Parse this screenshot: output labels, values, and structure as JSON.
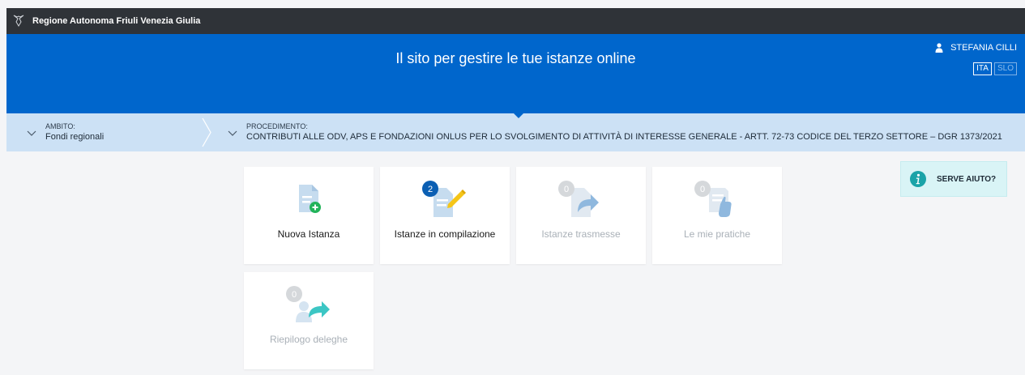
{
  "topbar": {
    "region": "Regione Autonoma Friuli Venezia Giulia"
  },
  "header": {
    "title": "Il sito per gestire le tue istanze online",
    "user": "STEFANIA CILLI",
    "languages": [
      "ITA",
      "SLO"
    ]
  },
  "breadcrumb": {
    "ambito_label": "AMBITO:",
    "ambito_value": "Fondi regionali",
    "procedimento_label": "PROCEDIMENTO:",
    "procedimento_value": "CONTRIBUTI ALLE ODV, APS E FONDAZIONI ONLUS PER LO SVOLGIMENTO DI ATTIVITÀ DI INTERESSE GENERALE - ARTT. 72-73 CODICE DEL TERZO SETTORE – DGR 1373/2021"
  },
  "tiles": [
    {
      "label": "Nuova Istanza",
      "badge": "",
      "state": "active"
    },
    {
      "label": "Istanze in compilazione",
      "badge": "2",
      "state": "active"
    },
    {
      "label": "Istanze trasmesse",
      "badge": "0",
      "state": "disabled"
    },
    {
      "label": "Le mie pratiche",
      "badge": "0",
      "state": "disabled"
    },
    {
      "label": "Riepilogo deleghe",
      "badge": "0",
      "state": "disabled"
    }
  ],
  "help": {
    "label": "SERVE AIUTO?"
  },
  "colors": {
    "primary": "#0066cc",
    "topbar": "#2f3338",
    "crumb_bg": "#cce1f5",
    "accent_green": "#22b35a",
    "badge_blue": "#0b5fb3",
    "help_bg": "#d9f4f6",
    "info_teal": "#1aa3a8"
  }
}
